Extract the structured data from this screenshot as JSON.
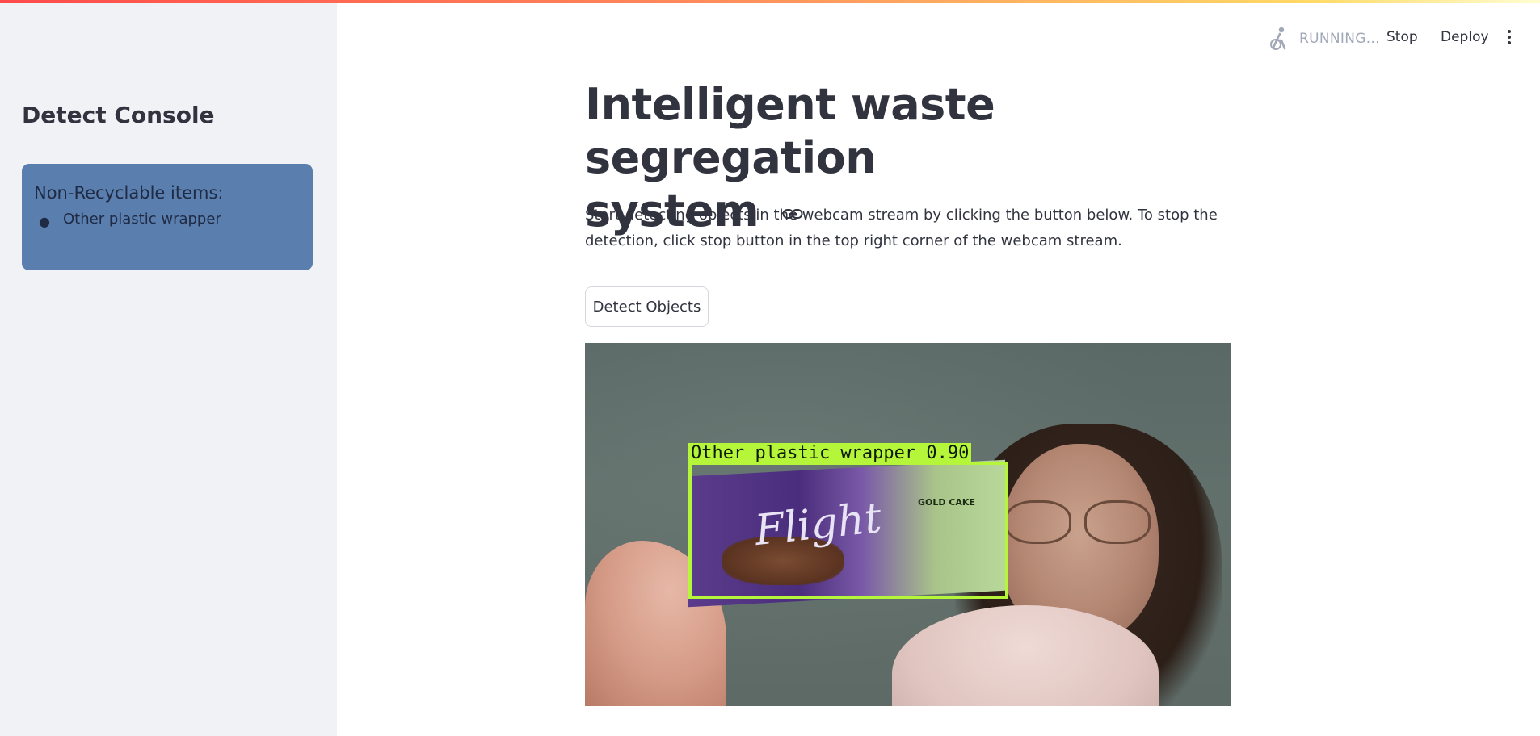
{
  "sidebar": {
    "title": "Detect Console",
    "info_box": {
      "title": "Non-Recyclable items:",
      "items": [
        "Other plastic wrapper"
      ]
    }
  },
  "header": {
    "status_label": "RUNNING...",
    "stop_label": "Stop",
    "deploy_label": "Deploy",
    "icons": {
      "status": "running-figure-icon",
      "menu": "more-vertical-icon"
    }
  },
  "main": {
    "title_line1": "Intelligent waste segregation",
    "title_line2": "system",
    "description": "Start detecting objects in the webcam stream by clicking the button below. To stop the detection, click stop button in the top right corner of the webcam stream.",
    "detect_button_label": "Detect Objects",
    "link_icon": "link-icon"
  },
  "webcam": {
    "detection_label": "Other plastic wrapper 0.90",
    "package_brand": "Flight",
    "package_logo": "GOLD CAKE",
    "box_color": "#b5f53a"
  },
  "colors": {
    "sidebar_bg": "#f0f2f6",
    "info_box_bg": "#5a7ead",
    "text": "#31333f",
    "accent": "#ff4b4b"
  }
}
